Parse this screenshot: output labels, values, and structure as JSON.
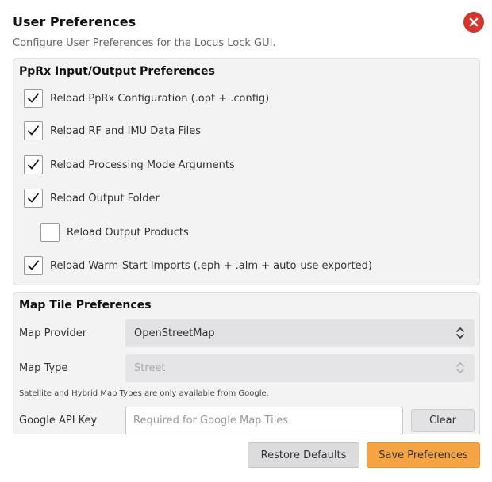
{
  "dialog": {
    "title": "User Preferences",
    "subtitle": "Configure User Preferences for the Locus Lock GUI.",
    "close_icon": "close-icon",
    "accent_color": "#d9342b"
  },
  "io_preferences": {
    "title": "PpRx Input/Output Preferences",
    "items": [
      {
        "label": "Reload PpRx Configuration (.opt + .config)",
        "checked": true
      },
      {
        "label": "Reload RF and IMU Data Files",
        "checked": true
      },
      {
        "label": "Reload Processing Mode Arguments",
        "checked": true
      },
      {
        "label": "Reload Output Folder",
        "checked": true
      },
      {
        "label": "Reload Output Products",
        "checked": false
      },
      {
        "label": "Reload Warm-Start Imports (.eph + .alm + auto-use exported)",
        "checked": true
      }
    ]
  },
  "map_preferences": {
    "title": "Map Tile Preferences",
    "provider_label": "Map Provider",
    "provider_value": "OpenStreetMap",
    "type_label": "Map Type",
    "type_value": "Street",
    "note": "Satellite and Hybrid Map Types are only available from Google.",
    "api_key_label": "Google API Key",
    "api_key_value": "",
    "api_key_placeholder": "Required for Google Map Tiles",
    "clear_label": "Clear"
  },
  "footer": {
    "restore_label": "Restore Defaults",
    "save_label": "Save Preferences",
    "save_color": "#f4a443"
  }
}
